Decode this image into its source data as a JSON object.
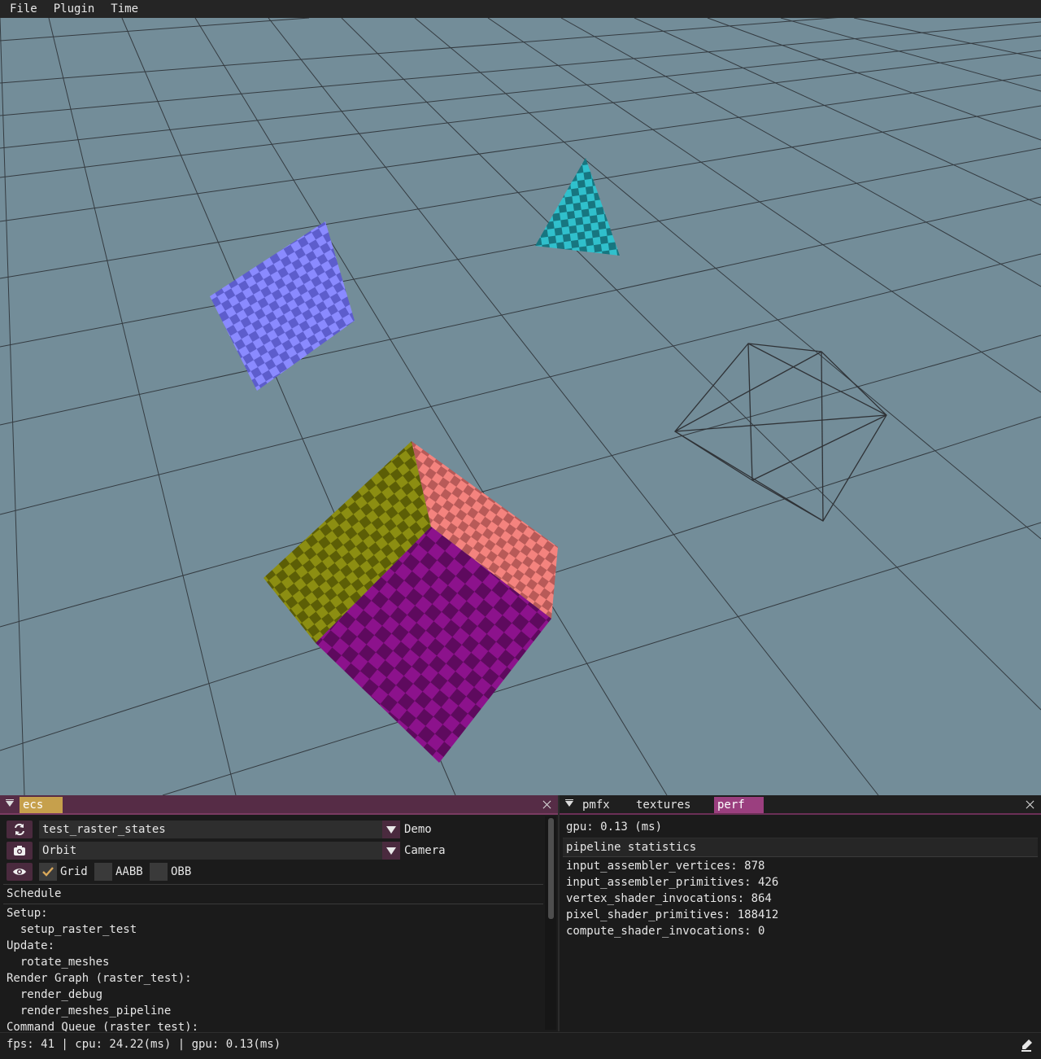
{
  "menu": {
    "items": [
      "File",
      "Plugin",
      "Time"
    ]
  },
  "viewport": {
    "background": "#738d99",
    "grid_color": "#2b2f33"
  },
  "ecs_panel": {
    "tab": "ecs",
    "demo_value": "test_raster_states",
    "demo_label": "Demo",
    "camera_value": "Orbit",
    "camera_label": "Camera",
    "toggles": {
      "grid": "Grid",
      "aabb": "AABB",
      "obb": "OBB",
      "grid_checked": true
    },
    "schedule_header": "Schedule",
    "schedule_lines": [
      "Setup:",
      "  setup_raster_test",
      "Update:",
      "  rotate_meshes",
      "Render Graph (raster_test):",
      "  render_debug",
      "  render_meshes_pipeline",
      "Command Queue (raster_test):"
    ]
  },
  "right_panel": {
    "tabs": [
      "pmfx",
      "textures",
      "perf"
    ],
    "active_tab": "perf",
    "gpu": "gpu: 0.13 (ms)",
    "stats_header": "pipeline statistics",
    "stats": [
      "input_assembler_vertices: 878",
      "input_assembler_primitives: 426",
      "vertex_shader_invocations: 864",
      "pixel_shader_primitives: 188412",
      "compute_shader_invocations: 0"
    ]
  },
  "status": {
    "text": "fps: 41 | cpu: 24.22(ms) | gpu: 0.13(ms)"
  },
  "colors": {
    "quad": "#7f7fff",
    "tetra": "#2ab3c0",
    "cube_left": "#8a8c10",
    "cube_right": "#f07c78",
    "cube_front": "#8c108c",
    "accent": "#9b3f7f"
  }
}
